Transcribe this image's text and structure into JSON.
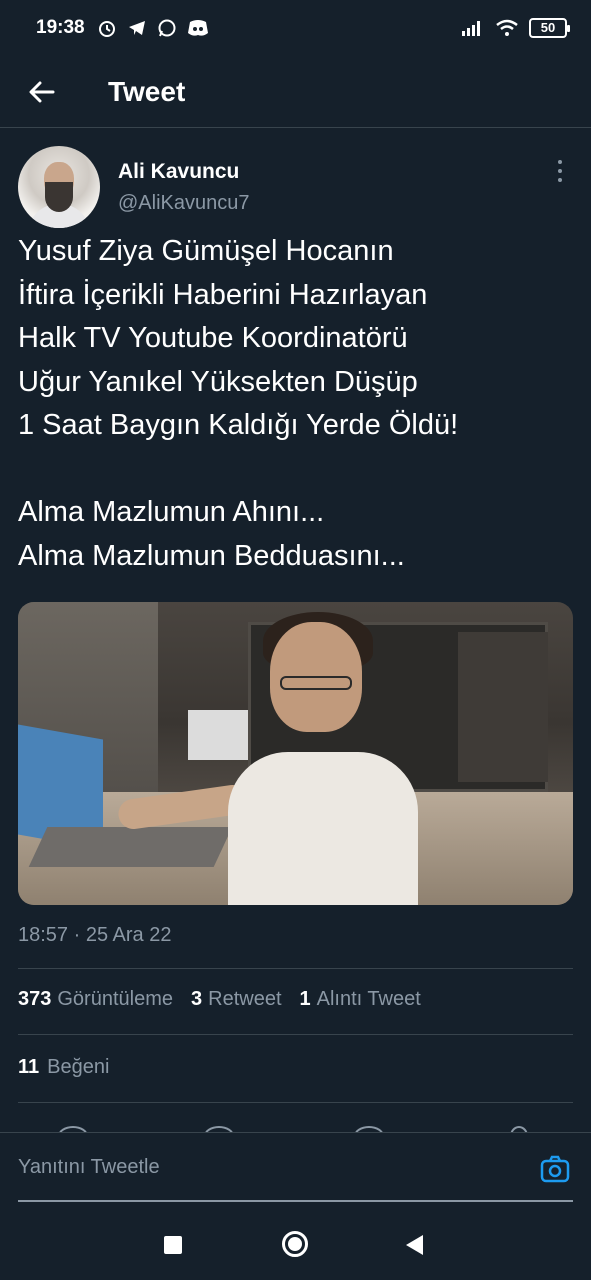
{
  "status_bar": {
    "time": "19:38",
    "left_icons": [
      "alarm-icon",
      "telegram-icon",
      "whatsapp-icon",
      "discord-icon"
    ],
    "right_icons": [
      "signal-icon",
      "wifi-icon"
    ],
    "battery": "50"
  },
  "header": {
    "back_icon": "arrow-left-icon",
    "title": "Tweet"
  },
  "tweet": {
    "author": {
      "name": "Ali Kavuncu",
      "handle": "@AliKavuncu7"
    },
    "text": "Yusuf Ziya Gümüşel Hocanın\nİftira İçerikli Haberini Hazırlayan\nHalk TV Youtube Koordinatörü\nUğur Yanıkel Yüksekten Düşüp\n1 Saat Baygın Kaldığı Yerde Öldü!\n\nAlma Mazlumun Ahını...\nAlma Mazlumun Bedduasını...",
    "timestamp": "18:57 · 25 Ara 22",
    "stats": {
      "views_count": "373",
      "views_label": "Görüntüleme",
      "retweets_count": "3",
      "retweets_label": "Retweet",
      "quotes_count": "1",
      "quotes_label": "Alıntı Tweet",
      "likes_count": "11",
      "likes_label": "Beğeni"
    }
  },
  "reply": {
    "placeholder": "Yanıtını Tweetle",
    "camera_icon": "camera-icon"
  },
  "colors": {
    "background": "#15202b",
    "divider": "#38444d",
    "secondary_text": "#8b98a5",
    "accent": "#1d9bf0"
  }
}
